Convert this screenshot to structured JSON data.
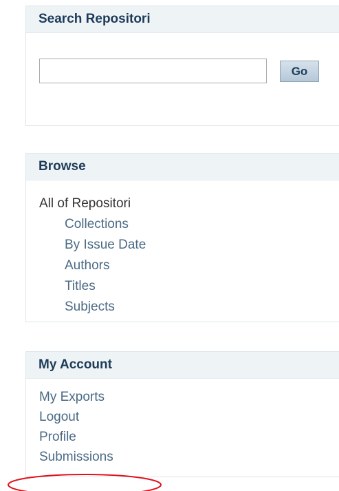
{
  "search": {
    "heading": "Search Repositori",
    "input_value": "",
    "input_placeholder": "",
    "go_label": "Go"
  },
  "browse": {
    "heading": "Browse",
    "root_label": "All of Repositori",
    "items": [
      {
        "label": "Collections"
      },
      {
        "label": "By Issue Date"
      },
      {
        "label": "Authors"
      },
      {
        "label": "Titles"
      },
      {
        "label": "Subjects"
      }
    ]
  },
  "account": {
    "heading": "My Account",
    "items": [
      {
        "label": "My Exports"
      },
      {
        "label": "Logout"
      },
      {
        "label": "Profile"
      },
      {
        "label": "Submissions"
      }
    ]
  },
  "colors": {
    "heading_bg": "#eef3f6",
    "heading_text": "#1d3b58",
    "link_text": "#4a6a85",
    "annotation_red": "#e0101a"
  }
}
